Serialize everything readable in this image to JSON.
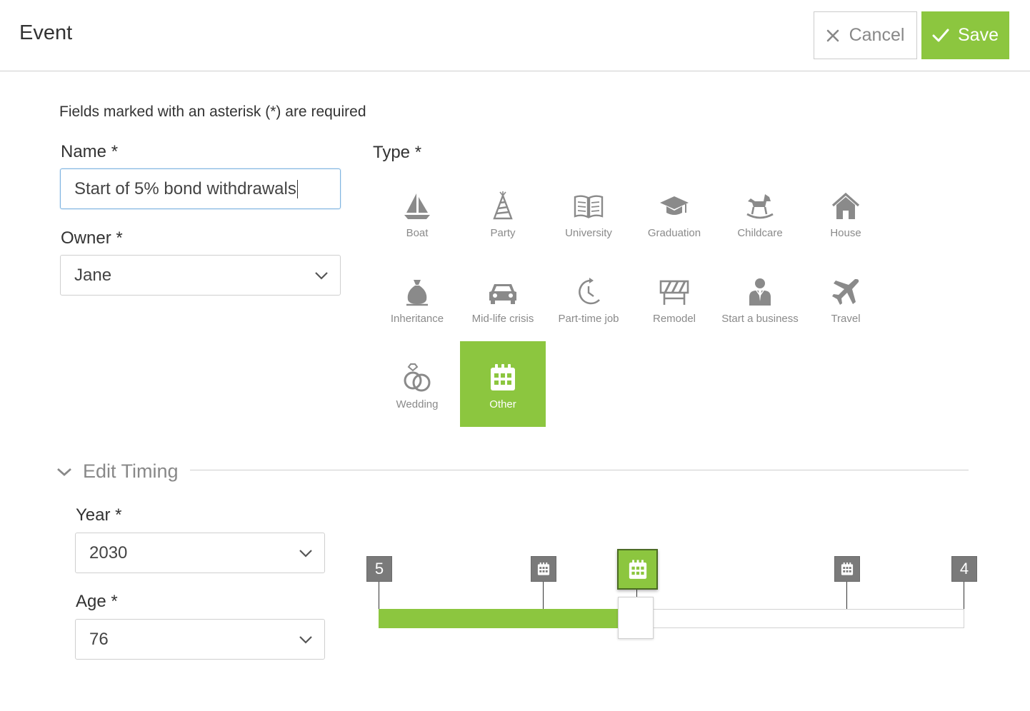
{
  "header": {
    "title": "Event",
    "cancel_label": "Cancel",
    "save_label": "Save"
  },
  "form": {
    "required_note": "Fields marked with an asterisk (*) are required",
    "name_label": "Name *",
    "name_value": "Start of 5% bond withdrawals",
    "owner_label": "Owner *",
    "owner_value": "Jane",
    "type_label": "Type *"
  },
  "types": [
    {
      "label": "Boat",
      "icon": "sailboat-icon"
    },
    {
      "label": "Party",
      "icon": "party-hat-icon"
    },
    {
      "label": "University",
      "icon": "open-book-icon"
    },
    {
      "label": "Graduation",
      "icon": "graduation-cap-icon"
    },
    {
      "label": "Childcare",
      "icon": "rocking-horse-icon"
    },
    {
      "label": "House",
      "icon": "house-icon"
    },
    {
      "label": "Inheritance",
      "icon": "money-bag-icon"
    },
    {
      "label": "Mid-life crisis",
      "icon": "car-icon"
    },
    {
      "label": "Part-time job",
      "icon": "clock-arrow-icon"
    },
    {
      "label": "Remodel",
      "icon": "construction-barrier-icon"
    },
    {
      "label": "Start a business",
      "icon": "businessman-icon"
    },
    {
      "label": "Travel",
      "icon": "airplane-icon"
    },
    {
      "label": "Wedding",
      "icon": "wedding-rings-icon"
    },
    {
      "label": "Other",
      "icon": "calendar-icon",
      "selected": true
    }
  ],
  "timing": {
    "section_label": "Edit Timing",
    "year_label": "Year *",
    "year_value": "2030",
    "age_label": "Age *",
    "age_value": "76"
  },
  "timeline": {
    "start_marker": "5",
    "end_marker": "4",
    "fill_fraction": 0.41
  },
  "colors": {
    "accent": "#8cc63f",
    "icon_gray": "#8a8a8a",
    "marker_gray": "#7a7a7a"
  }
}
